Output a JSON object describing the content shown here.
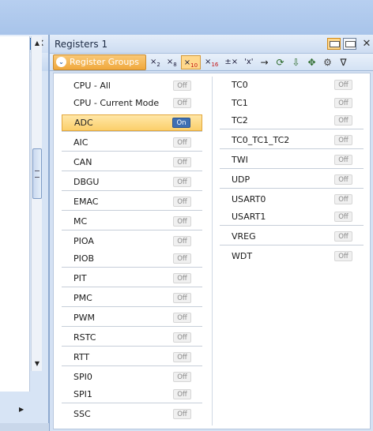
{
  "left_pane": {
    "pin_label": "⧉",
    "close_label": "✕",
    "tools": [
      "≡",
      "↵",
      "↲"
    ],
    "scroll_up": "▲",
    "scroll_down": "▼",
    "scroll_right": "▶"
  },
  "window": {
    "title": "Registers 1",
    "close_label": "✕"
  },
  "toolbar": {
    "group_button_label": "Register Groups",
    "group_chevron": "⌄",
    "tools": [
      {
        "main": "×",
        "sub": "2",
        "active": false
      },
      {
        "main": "×",
        "sub": "8",
        "active": false
      },
      {
        "main": "×",
        "sub": "10",
        "active": true
      },
      {
        "main": "×",
        "sub": "16",
        "active": false
      }
    ],
    "tool_pm": "±×",
    "tool_char": "'x'",
    "icons": [
      "arrow-right-icon",
      "refresh-icon",
      "export-icon",
      "group-icon",
      "settings-icon",
      "filter-icon"
    ],
    "icon_glyphs": [
      "→",
      "⟳",
      "⇩",
      "✥",
      "⚙",
      "∇"
    ]
  },
  "groups": {
    "left": [
      {
        "label": "CPU - All",
        "state": "Off",
        "selected": false
      },
      {
        "label": "CPU - Current Mode",
        "state": "Off",
        "selected": false
      },
      {
        "label": "ADC",
        "state": "On",
        "selected": true
      },
      {
        "label": "AIC",
        "state": "Off",
        "selected": false
      },
      {
        "label": "CAN",
        "state": "Off",
        "selected": false
      },
      {
        "label": "DBGU",
        "state": "Off",
        "selected": false
      },
      {
        "label": "EMAC",
        "state": "Off",
        "selected": false
      },
      {
        "label": "MC",
        "state": "Off",
        "selected": false
      },
      {
        "label": "PIOA",
        "state": "Off",
        "selected": false
      },
      {
        "label": "PIOB",
        "state": "Off",
        "selected": false
      },
      {
        "label": "PIT",
        "state": "Off",
        "selected": false
      },
      {
        "label": "PMC",
        "state": "Off",
        "selected": false
      },
      {
        "label": "PWM",
        "state": "Off",
        "selected": false
      },
      {
        "label": "RSTC",
        "state": "Off",
        "selected": false
      },
      {
        "label": "RTT",
        "state": "Off",
        "selected": false
      },
      {
        "label": "SPI0",
        "state": "Off",
        "selected": false
      },
      {
        "label": "SPI1",
        "state": "Off",
        "selected": false
      },
      {
        "label": "SSC",
        "state": "Off",
        "selected": false
      }
    ],
    "right": [
      {
        "label": "TC0",
        "state": "Off",
        "selected": false
      },
      {
        "label": "TC1",
        "state": "Off",
        "selected": false
      },
      {
        "label": "TC2",
        "state": "Off",
        "selected": false
      },
      {
        "label": "TC0_TC1_TC2",
        "state": "Off",
        "selected": false
      },
      {
        "label": "TWI",
        "state": "Off",
        "selected": false
      },
      {
        "label": "UDP",
        "state": "Off",
        "selected": false
      },
      {
        "label": "USART0",
        "state": "Off",
        "selected": false
      },
      {
        "label": "USART1",
        "state": "Off",
        "selected": false
      },
      {
        "label": "VREG",
        "state": "Off",
        "selected": false
      },
      {
        "label": "WDT",
        "state": "Off",
        "selected": false
      }
    ]
  }
}
